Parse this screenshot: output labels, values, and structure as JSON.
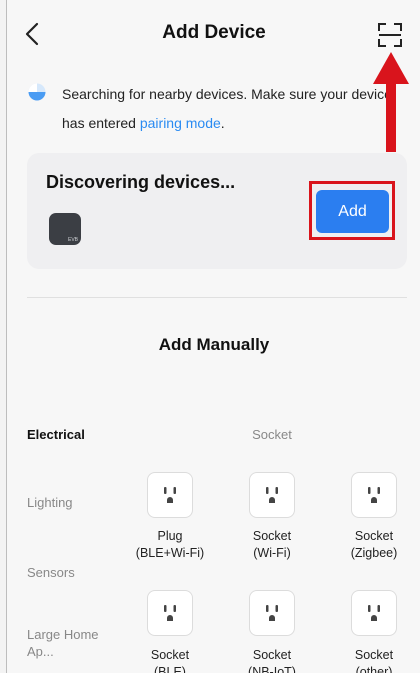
{
  "header": {
    "title": "Add Device",
    "back_icon": "chevron-left-icon",
    "scan_icon": "scan-icon"
  },
  "searching": {
    "text": "Searching for nearby devices. Make sure your device has entered ",
    "link": "pairing mode",
    "suffix": "."
  },
  "discover": {
    "title": "Discovering devices...",
    "device_thumb_label": "EVB",
    "add_label": "Add"
  },
  "add_manually": {
    "title": "Add Manually"
  },
  "categories": [
    {
      "label": "Electrical",
      "active": true
    },
    {
      "label": "Lighting",
      "active": false
    },
    {
      "label": "Sensors",
      "active": false
    },
    {
      "label": "Large Home Ap...",
      "active": false
    }
  ],
  "section": {
    "title": "Socket",
    "items": [
      {
        "name": "Plug",
        "sub": "(BLE+Wi-Fi)"
      },
      {
        "name": "Socket",
        "sub": "(Wi-Fi)"
      },
      {
        "name": "Socket",
        "sub": "(Zigbee)"
      },
      {
        "name": "Socket",
        "sub": "(BLE)"
      },
      {
        "name": "Socket",
        "sub": "(NB-IoT)"
      },
      {
        "name": "Socket",
        "sub": "(other)"
      }
    ]
  },
  "colors": {
    "accent": "#2b7ef0",
    "highlight": "#d9141c",
    "link": "#2a8bf2"
  }
}
